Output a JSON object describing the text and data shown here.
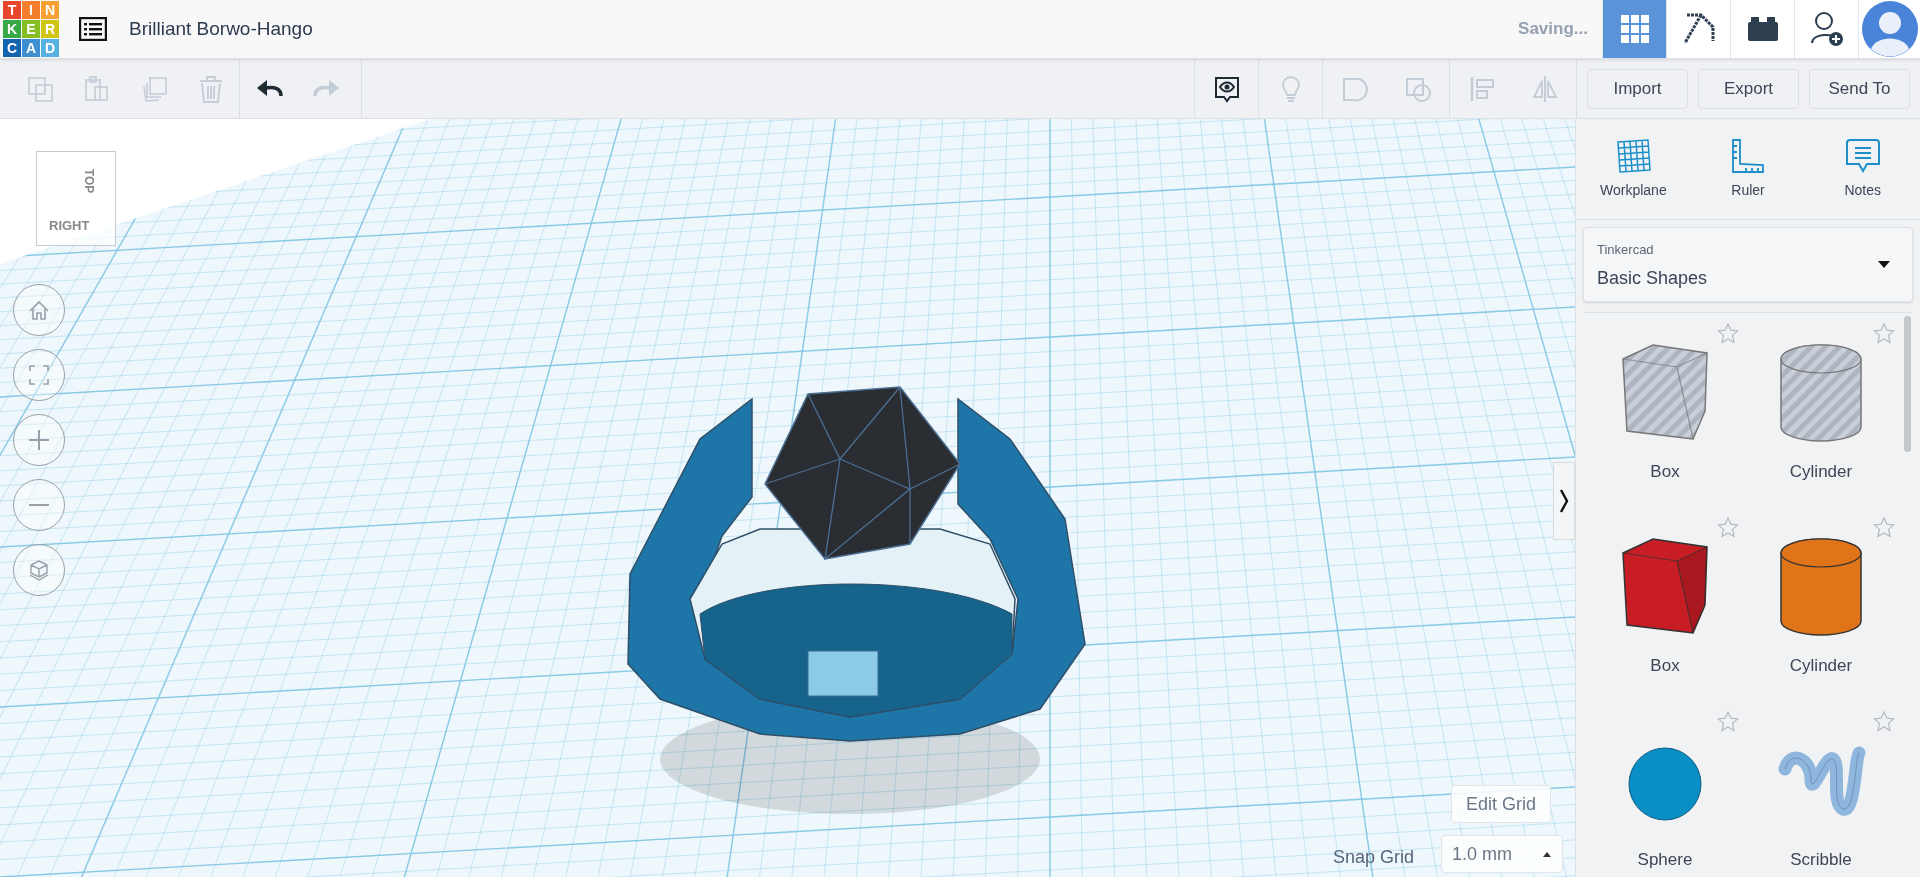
{
  "header": {
    "logo_letters": [
      "T",
      "I",
      "N",
      "K",
      "E",
      "R",
      "C",
      "A",
      "D"
    ],
    "title": "Brilliant Borwo-Hango",
    "status": "Saving...",
    "nav": [
      {
        "kind": "grid",
        "selected": true
      },
      {
        "kind": "pickaxe",
        "selected": false
      },
      {
        "kind": "brick",
        "selected": false
      },
      {
        "kind": "add-user",
        "selected": false
      },
      {
        "kind": "avatar",
        "selected": false
      }
    ]
  },
  "toolbar": {
    "edit_tools": [
      {
        "kind": "copy",
        "disabled": true
      },
      {
        "kind": "paste",
        "disabled": true
      },
      {
        "kind": "duplicate",
        "disabled": true
      },
      {
        "kind": "delete",
        "disabled": true
      }
    ],
    "history": [
      {
        "kind": "undo",
        "disabled": false
      },
      {
        "kind": "redo",
        "disabled": true
      }
    ],
    "view_tools": [
      {
        "kind": "notes-toggle",
        "disabled": false
      },
      {
        "kind": "bulb",
        "disabled": true
      },
      {
        "kind": "group",
        "disabled": true
      },
      {
        "kind": "subtract",
        "disabled": true
      },
      {
        "kind": "align",
        "disabled": true
      },
      {
        "kind": "mirror",
        "disabled": true
      }
    ],
    "buttons": [
      "Import",
      "Export",
      "Send To"
    ]
  },
  "canvas": {
    "view_cube": [
      "TOP",
      "RIGHT"
    ],
    "view_controls": [
      {
        "kind": "home"
      },
      {
        "kind": "fit"
      },
      {
        "kind": "zoom-in"
      },
      {
        "kind": "zoom-out"
      },
      {
        "kind": "perspective"
      }
    ],
    "edit_grid": "Edit Grid",
    "snap_grid_label": "Snap Grid",
    "snap_grid_value": "1.0 mm"
  },
  "panel": {
    "tools": [
      {
        "kind": "workplane",
        "label": "Workplane"
      },
      {
        "kind": "ruler",
        "label": "Ruler"
      },
      {
        "kind": "notes",
        "label": "Notes"
      }
    ],
    "library": {
      "provider": "Tinkercad",
      "value": "Basic Shapes"
    },
    "shapes": [
      {
        "kind": "box",
        "hole": true,
        "label": "Box",
        "favorite": false
      },
      {
        "kind": "cylinder",
        "hole": true,
        "label": "Cylinder",
        "favorite": false
      },
      {
        "kind": "box",
        "hole": false,
        "color": "#c81d25",
        "label": "Box",
        "favorite": false
      },
      {
        "kind": "cylinder",
        "hole": false,
        "color": "#e07418",
        "label": "Cylinder",
        "favorite": false
      },
      {
        "kind": "sphere",
        "hole": false,
        "color": "#0a8fc4",
        "label": "Sphere",
        "favorite": false
      },
      {
        "kind": "scribble",
        "hole": false,
        "color": "#8fb6dc",
        "label": "Scribble",
        "favorite": false
      }
    ]
  }
}
